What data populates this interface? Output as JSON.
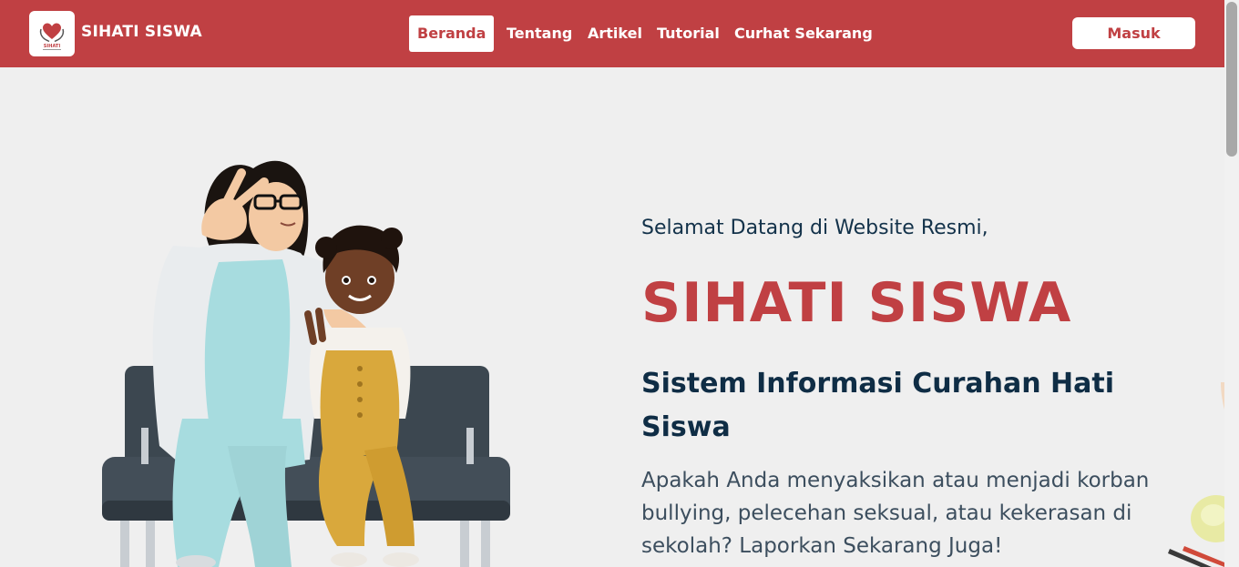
{
  "navbar": {
    "brand": "SIHATI SISWA",
    "logo_text": "SIHATI",
    "nav_items": [
      {
        "label": "Beranda",
        "active": true
      },
      {
        "label": "Tentang",
        "active": false
      },
      {
        "label": "Artikel",
        "active": false
      },
      {
        "label": "Tutorial",
        "active": false
      },
      {
        "label": "Curhat Sekarang",
        "active": false
      }
    ],
    "login_label": "Masuk"
  },
  "hero": {
    "welcome": "Selamat Datang di Website Resmi,",
    "title": "SIHATI SISWA",
    "subtitle": "Sistem Informasi Curahan Hati Siswa",
    "description": "Apakah Anda menyaksikan atau menjadi korban bullying, pelecehan seksual, atau kekerasan di sekolah? Laporkan Sekarang Juga!"
  },
  "colors": {
    "brand": "#c04043",
    "heading": "#0f2d45",
    "background": "#efefef"
  },
  "icons": {
    "logo": "heart-hands-icon"
  }
}
